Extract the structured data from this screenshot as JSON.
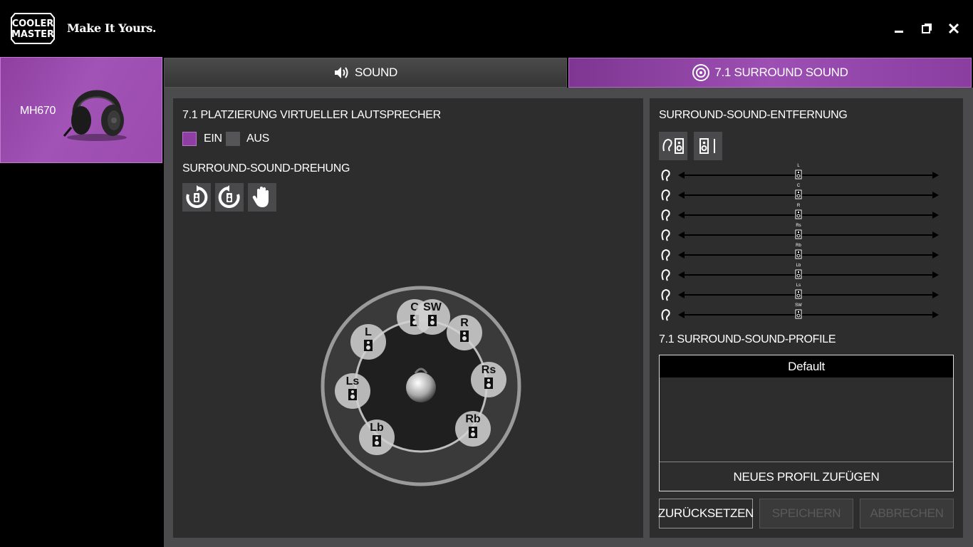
{
  "app": {
    "brand_line1": "COOLER",
    "brand_line2": "MASTER",
    "tagline": "Make It Yours."
  },
  "window_controls": [
    "minimize-icon",
    "maximize-icon",
    "close-icon"
  ],
  "sidebar": {
    "device_name": "MH670"
  },
  "tabs": [
    {
      "label": "SOUND",
      "icon": "speaker-volume-icon",
      "active": false
    },
    {
      "label": "7.1 SURROUND SOUND",
      "icon": "surround-speaker-icon",
      "active": true
    }
  ],
  "left_panel": {
    "placement_heading": "7.1 PLATZIERUNG VIRTUELLER LAUTSPRECHER",
    "on_label": "EIN",
    "off_label": "AUS",
    "placement_on": true,
    "rotation_heading": "SURROUND-SOUND-DREHUNG",
    "rotation_buttons": [
      "rotate-clockwise-icon",
      "rotate-counterclockwise-icon",
      "hand-drag-icon"
    ],
    "speakers": [
      "C",
      "SW",
      "L",
      "R",
      "Ls",
      "Rs",
      "Lb",
      "Rb"
    ]
  },
  "right_panel": {
    "distance_heading": "SURROUND-SOUND-ENTFERNUNG",
    "distance_mode_buttons": [
      "ear-speaker-icon",
      "speaker-line-icon"
    ],
    "distance_channels": [
      "L",
      "C",
      "R",
      "Rs",
      "Rb",
      "Lb",
      "Ls",
      "SW"
    ],
    "profiles_heading": "7.1 SURROUND-SOUND-PROFILE",
    "profiles": [
      "Default"
    ],
    "add_profile_label": "NEUES PROFIL ZUFÜGEN",
    "reset_label": "ZURÜCKSETZEN",
    "save_label": "SPEICHERN",
    "cancel_label": "ABBRECHEN"
  },
  "colors": {
    "accent": "#9b4bad",
    "panel": "#2d2d2d",
    "frame": "#4b4b4d"
  }
}
